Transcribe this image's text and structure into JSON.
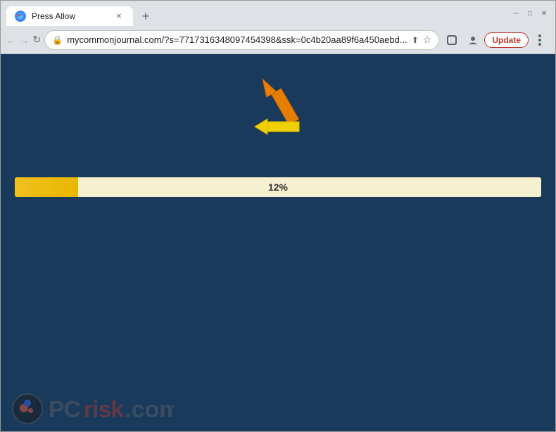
{
  "window": {
    "title": "Press Allow",
    "favicon": "●"
  },
  "tabs": [
    {
      "label": "Press Allow",
      "active": true,
      "favicon": "🔵"
    }
  ],
  "toolbar": {
    "url": "mycommonjournal.com/?s=7717316348097454398&ssk=0c4b20aa89f6a450aebd...",
    "back_label": "←",
    "forward_label": "→",
    "reload_label": "↻",
    "new_tab_label": "+",
    "update_label": "Update",
    "minimize_label": "─",
    "maximize_label": "□",
    "close_label": "✕"
  },
  "page": {
    "background_color": "#1a3a5c",
    "progress_value": 12,
    "progress_label": "12%",
    "progress_fill_width": "12%"
  },
  "watermark": {
    "text": "risk.com",
    "prefix": "PC"
  }
}
